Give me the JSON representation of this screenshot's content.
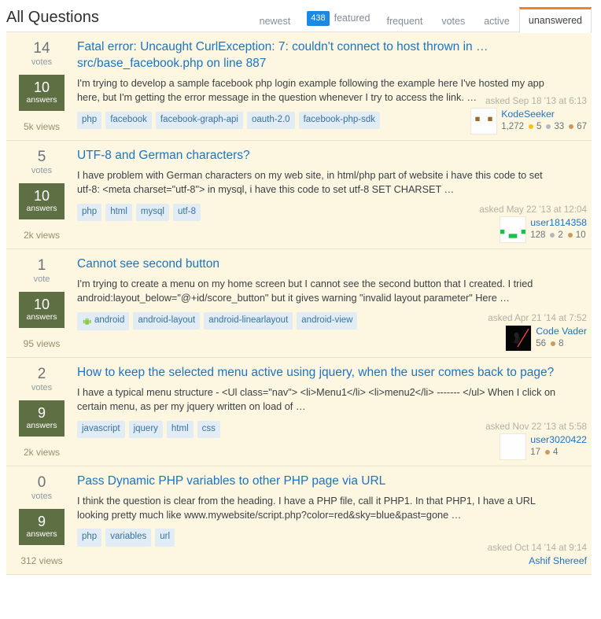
{
  "header": {
    "title": "All Questions",
    "tabs": [
      {
        "label": "newest",
        "active": false,
        "badge": null
      },
      {
        "label": "featured",
        "active": false,
        "badge": "438"
      },
      {
        "label": "frequent",
        "active": false,
        "badge": null
      },
      {
        "label": "votes",
        "active": false,
        "badge": null
      },
      {
        "label": "active",
        "active": false,
        "badge": null
      },
      {
        "label": "unanswered",
        "active": true,
        "badge": null
      }
    ],
    "active_tab_accent": "#f48024",
    "badge_color": "#1a8ae5"
  },
  "questions": [
    {
      "votes": "14",
      "votes_label": "votes",
      "answers": "10",
      "answers_label": "answers",
      "views": "5k views",
      "title": "Fatal error: Uncaught CurlException: 7: couldn't connect to host thrown in …src/base_facebook.php on line 887",
      "excerpt": "I'm trying to develop a sample facebook php login example following the example here I've hosted my app here, but I'm getting the error message in the question whenever I try to access the link. …",
      "tags": [
        "php",
        "facebook",
        "facebook-graph-api",
        "oauth-2.0",
        "facebook-php-sdk"
      ],
      "asked": "asked Sep 18 '13 at 6:13",
      "user": "KodeSeeker",
      "reputation": "1,272",
      "gold": "5",
      "silver": "33",
      "bronze": "67",
      "avatar_style": "brown-identicon"
    },
    {
      "votes": "5",
      "votes_label": "votes",
      "answers": "10",
      "answers_label": "answers",
      "views": "2k views",
      "title": "UTF-8 and German characters?",
      "excerpt": "I have problem with German characters on my web site, in html/php part of website i have this code to set utf-8: <meta charset=\"utf-8\"> in mysql, i have this code to set utf-8 SET CHARSET …",
      "tags": [
        "php",
        "html",
        "mysql",
        "utf-8"
      ],
      "asked": "asked May 22 '13 at 12:04",
      "user": "user1814358",
      "reputation": "128",
      "gold": null,
      "silver": "2",
      "bronze": "10",
      "avatar_style": "green-identicon"
    },
    {
      "votes": "1",
      "votes_label": "vote",
      "answers": "10",
      "answers_label": "answers",
      "views": "95 views",
      "title": "Cannot see second button",
      "excerpt": "I'm trying to create a menu on my home screen but I cannot see the second button that I created. I tried android:layout_below=\"@+id/score_button\" but it gives warning \"invalid layout parameter\" Here …",
      "tags": [
        "android",
        "android-layout",
        "android-linearlayout",
        "android-view"
      ],
      "tag_icons": {
        "android": "android-icon"
      },
      "asked": "asked Apr 21 '14 at 7:52",
      "user": "Code Vader",
      "reputation": "56",
      "gold": null,
      "silver": null,
      "bronze": "8",
      "avatar_style": "vader-photo"
    },
    {
      "votes": "2",
      "votes_label": "votes",
      "answers": "9",
      "answers_label": "answers",
      "views": "2k views",
      "title": "How to keep the selected menu active using jquery, when the user comes back to page?",
      "excerpt": "I have a typical menu structure - <Ul class=\"nav\"> <li>Menu1</li> <li>menu2</li> ------- </ul> When I click on certain menu, as per my jquery written on load of …",
      "tags": [
        "javascript",
        "jquery",
        "html",
        "css"
      ],
      "asked": "asked Nov 22 '13 at 5:58",
      "user": "user3020422",
      "reputation": "17",
      "gold": null,
      "silver": null,
      "bronze": "4",
      "avatar_style": "navy-identicon"
    },
    {
      "votes": "0",
      "votes_label": "votes",
      "answers": "9",
      "answers_label": "answers",
      "views": "312 views",
      "title": "Pass Dynamic PHP variables to other PHP page via URL",
      "excerpt": "I think the question is clear from the heading. I have a PHP file, call it PHP1. In that PHP1, I have a URL looking pretty much like www.mywebsite/script.php?color=red&sky=blue&past=gone …",
      "tags": [
        "php",
        "variables",
        "url"
      ],
      "asked": "asked Oct 14 '14 at 9:14",
      "user": "Ashif Shereef",
      "reputation": null,
      "gold": null,
      "silver": null,
      "bronze": null,
      "avatar_style": "none"
    }
  ],
  "colors": {
    "row_background": "#fdf7e2",
    "answer_box": "#5d6f43",
    "link": "#1b74c4",
    "tag_background": "#e1ecf4",
    "tag_text": "#39739d"
  }
}
